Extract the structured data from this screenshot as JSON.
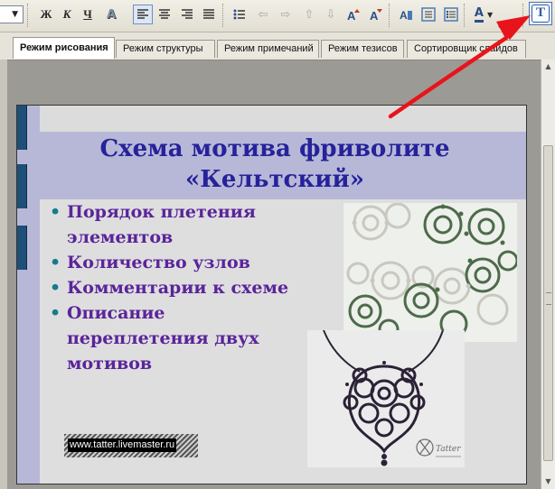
{
  "toolbar": {
    "bold": "Ж",
    "italic": "К",
    "underline": "Ч",
    "shadow": "A",
    "text_tool": "T",
    "font_color_label": "A",
    "items": [
      "font-size-dropdown",
      "bold",
      "italic",
      "underline",
      "shadow",
      "align-left",
      "align-center",
      "align-right",
      "justify",
      "bullets",
      "outdent",
      "indent",
      "move-up",
      "move-down",
      "paragraph-spacing-up",
      "paragraph-spacing-down",
      "character",
      "paragraph",
      "bullets-numbering",
      "font-color",
      "more",
      "text-tool"
    ]
  },
  "tabs": [
    {
      "label": "Режим рисования",
      "active": true
    },
    {
      "label": "Режим структуры",
      "active": false
    },
    {
      "label": "Режим примечаний",
      "active": false
    },
    {
      "label": "Режим тезисов",
      "active": false
    },
    {
      "label": "Сортировщик слайдов",
      "active": false
    }
  ],
  "slide": {
    "title_line1": "Схема мотива фриволите",
    "title_line2": "«Кельтский»",
    "bullets": [
      "Порядок плетения элементов",
      "Количество узлов",
      "Комментарии к схеме",
      "Описание переплетения двух мотивов"
    ],
    "watermark": "www.tatter.livemaster.ru",
    "photo_signature": "Tatter"
  },
  "colors": {
    "title": "#26229a",
    "bullet_text": "#5a249a",
    "bullet_marker": "#157c8e",
    "title_band": "#b7b8d7",
    "stripe_notches": "#1e4f78",
    "annotation_arrow": "#e8141b"
  },
  "annotation": {
    "type": "arrow",
    "points_to": "text-tool-button"
  }
}
